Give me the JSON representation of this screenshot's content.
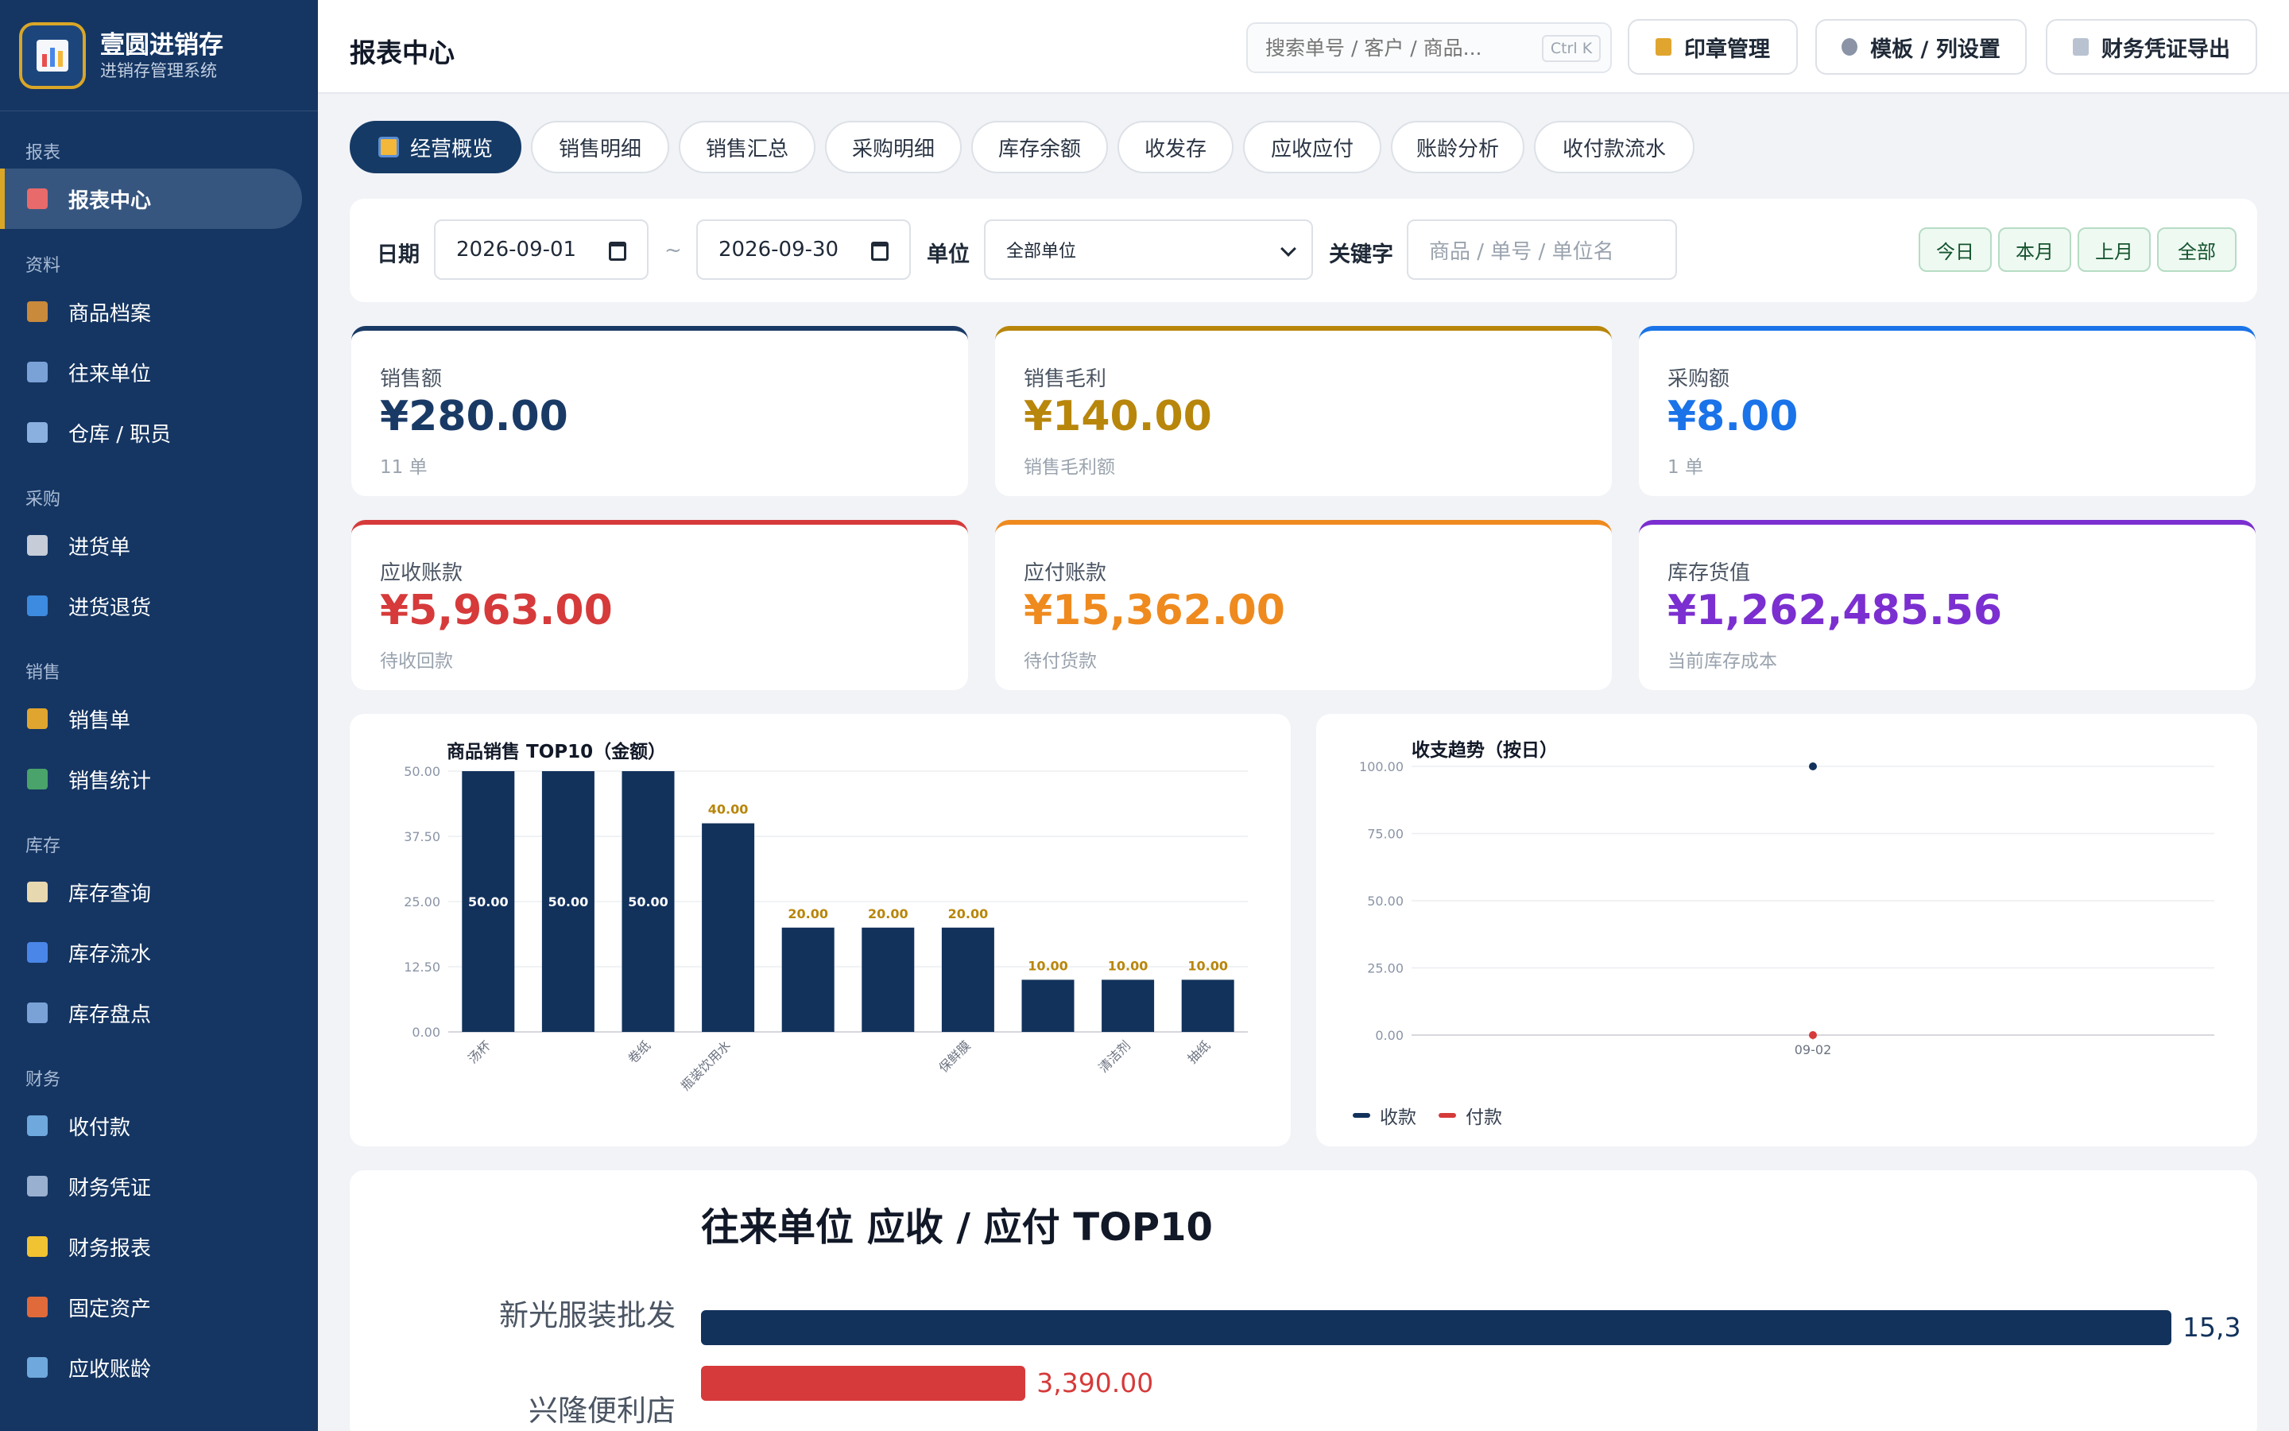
{
  "app": {
    "title": "壹圆进销存",
    "subtitle": "进销存管理系统"
  },
  "sidebar": {
    "groups": [
      {
        "label": "报表",
        "items": [
          {
            "label": "报表中心",
            "icon": "report-icon",
            "active": true
          }
        ]
      },
      {
        "label": "资料",
        "items": [
          {
            "label": "商品档案",
            "icon": "box-icon"
          },
          {
            "label": "往来单位",
            "icon": "building-icon"
          },
          {
            "label": "仓库 / 职员",
            "icon": "warehouse-icon"
          }
        ]
      },
      {
        "label": "采购",
        "items": [
          {
            "label": "进货单",
            "icon": "cart-icon"
          },
          {
            "label": "进货退货",
            "icon": "return-icon"
          }
        ]
      },
      {
        "label": "销售",
        "items": [
          {
            "label": "销售单",
            "icon": "money-bag-icon"
          },
          {
            "label": "销售统计",
            "icon": "chart-icon"
          }
        ]
      },
      {
        "label": "库存",
        "items": [
          {
            "label": "库存查询",
            "icon": "clipboard-icon"
          },
          {
            "label": "库存流水",
            "icon": "wave-icon"
          },
          {
            "label": "库存盘点",
            "icon": "magnifier-icon"
          }
        ]
      },
      {
        "label": "财务",
        "items": [
          {
            "label": "收付款",
            "icon": "card-icon"
          },
          {
            "label": "财务凭证",
            "icon": "receipt-icon"
          },
          {
            "label": "财务报表",
            "icon": "ledger-icon"
          },
          {
            "label": "固定资产",
            "icon": "crane-icon"
          },
          {
            "label": "应收账龄",
            "icon": "bar-chart-icon"
          }
        ]
      }
    ]
  },
  "header": {
    "title": "报表中心",
    "search_placeholder": "搜索单号 / 客户 / 商品...",
    "search_shortcut": "Ctrl K",
    "buttons": [
      {
        "label": "印章管理",
        "icon": "stamp-icon"
      },
      {
        "label": "模板 / 列设置",
        "icon": "gear-icon"
      },
      {
        "label": "财务凭证导出",
        "icon": "document-icon"
      }
    ]
  },
  "tabs": [
    {
      "label": "经营概览",
      "active": true
    },
    {
      "label": "销售明细"
    },
    {
      "label": "销售汇总"
    },
    {
      "label": "采购明细"
    },
    {
      "label": "库存余额"
    },
    {
      "label": "收发存"
    },
    {
      "label": "应收应付"
    },
    {
      "label": "账龄分析"
    },
    {
      "label": "收付款流水"
    }
  ],
  "filters": {
    "date_label": "日期",
    "date_from": "2026-09-01",
    "date_sep": "~",
    "date_to": "2026-09-30",
    "unit_label": "单位",
    "unit_value": "全部单位",
    "keyword_label": "关键字",
    "keyword_placeholder": "商品 / 单号 / 单位名",
    "quick": [
      "今日",
      "本月",
      "上月",
      "全部"
    ]
  },
  "kpis": [
    {
      "label": "销售额",
      "value": "¥280.00",
      "sub": "11 单",
      "color": "#1a3a66"
    },
    {
      "label": "销售毛利",
      "value": "¥140.00",
      "sub": "销售毛利额",
      "color": "#b8860b"
    },
    {
      "label": "采购额",
      "value": "¥8.00",
      "sub": "1 单",
      "color": "#1a73e8"
    },
    {
      "label": "应收账款",
      "value": "¥5,963.00",
      "sub": "待收回款",
      "color": "#d63a3a"
    },
    {
      "label": "应付账款",
      "value": "¥15,362.00",
      "sub": "待付货款",
      "color": "#ef8a1f"
    },
    {
      "label": "库存货值",
      "value": "¥1,262,485.56",
      "sub": "当前库存成本",
      "color": "#7b2fd0"
    }
  ],
  "chart_data": [
    {
      "type": "bar",
      "title": "商品销售 TOP10（金额）",
      "categories": [
        "汤杯",
        "",
        "卷纸",
        "瓶装饮用水",
        "",
        "",
        "保鲜膜",
        "",
        "清洁剂",
        "抽纸"
      ],
      "values": [
        50,
        50,
        50,
        40,
        20,
        20,
        20,
        10,
        10,
        10
      ],
      "data_labels": [
        "50.00",
        "50.00",
        "50.00",
        "40.00",
        "20.00",
        "20.00",
        "20.00",
        "10.00",
        "10.00",
        "10.00"
      ],
      "yticks": [
        "0.00",
        "12.50",
        "25.00",
        "37.50",
        "50.00"
      ],
      "ylim": [
        0,
        50
      ],
      "grid": true,
      "color": "#12325c"
    },
    {
      "type": "line",
      "title": "收支趋势（按日）",
      "x": [
        "09-02"
      ],
      "series": [
        {
          "name": "收款",
          "values": [
            100
          ],
          "color": "#12325c"
        },
        {
          "name": "付款",
          "values": [
            0
          ],
          "color": "#d63a3a"
        }
      ],
      "yticks": [
        "0.00",
        "25.00",
        "50.00",
        "75.00",
        "100.00"
      ],
      "ylim": [
        0,
        100
      ],
      "grid": true,
      "legend": "bottom-left"
    },
    {
      "type": "bar",
      "orientation": "horizontal",
      "title": "往来单位 应收 / 应付 TOP10",
      "categories": [
        "新光服装批发",
        "兴隆便利店"
      ],
      "values": [
        15362,
        3390
      ],
      "value_labels": [
        "15,3",
        "3,390.00"
      ],
      "colors": [
        "#12325c",
        "#d63a3a"
      ],
      "xmax": 15362
    }
  ]
}
